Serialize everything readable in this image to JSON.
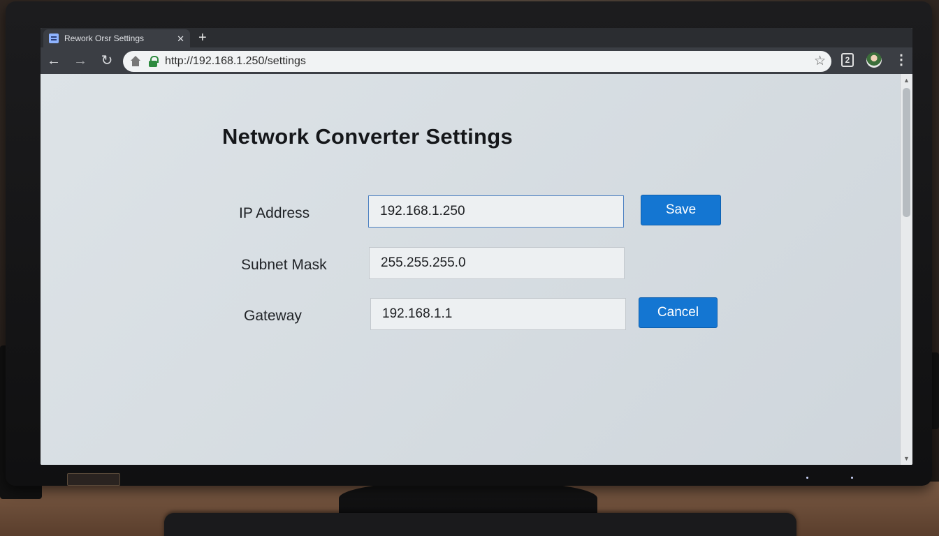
{
  "browser": {
    "tab": {
      "title": "Rework Orsr Settings",
      "close_icon": "close-icon",
      "favicon": "document-icon"
    },
    "new_tab_glyph": "+",
    "nav": {
      "back_icon": "back-arrow-icon",
      "forward_icon": "forward-arrow-icon",
      "reload_icon": "reload-icon"
    },
    "address": {
      "url": "http://192.168.1.250/settings",
      "home_icon": "home-icon",
      "lock_icon": "lock-icon",
      "bookmark_icon": "star-icon"
    },
    "toolbar_icons": [
      "extension-icon",
      "avatar-icon",
      "menu-icon"
    ]
  },
  "page": {
    "title": "Network Converter Settings",
    "fields": [
      {
        "label": "IP Address",
        "value": "192.168.1.250"
      },
      {
        "label": "Subnet Mask",
        "value": "255.255.255.0"
      },
      {
        "label": "Gateway",
        "value": "192.168.1.1"
      }
    ],
    "save_label": "Save",
    "cancel_label": "Cancel"
  },
  "colors": {
    "accent": "#1476d2",
    "background": "#dde3e7"
  }
}
